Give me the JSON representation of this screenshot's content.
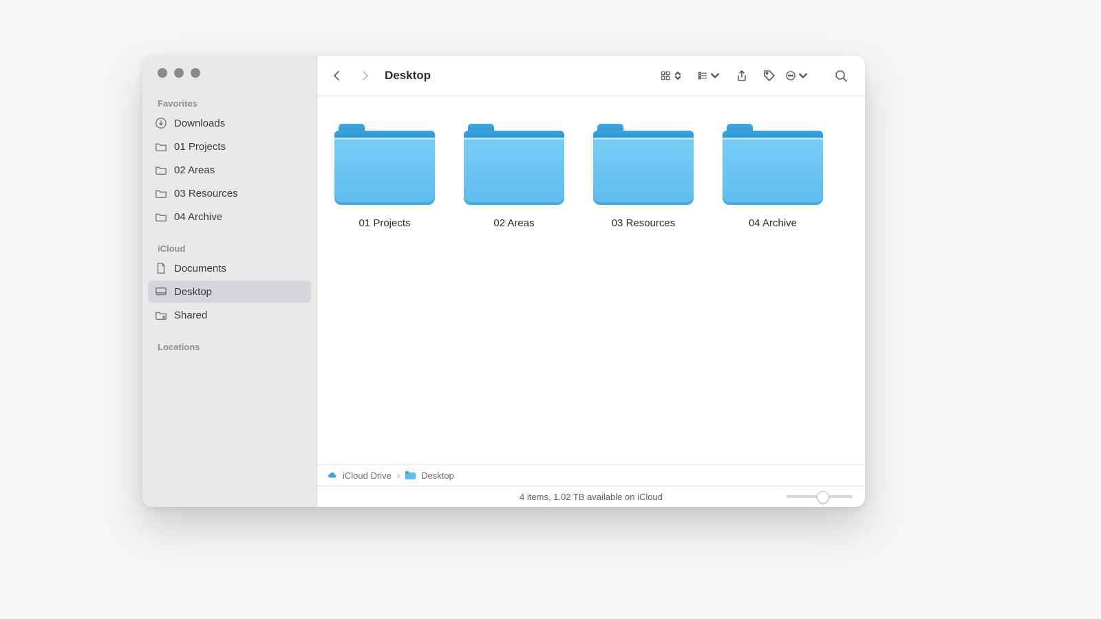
{
  "header": {
    "title": "Desktop"
  },
  "sidebar": {
    "favorites_header": "Favorites",
    "icloud_header": "iCloud",
    "locations_header": "Locations",
    "favorites": [
      {
        "label": "Downloads",
        "icon": "download"
      },
      {
        "label": "01 Projects",
        "icon": "folder"
      },
      {
        "label": "02 Areas",
        "icon": "folder"
      },
      {
        "label": "03 Resources",
        "icon": "folder"
      },
      {
        "label": "04 Archive",
        "icon": "folder"
      }
    ],
    "icloud": [
      {
        "label": "Documents",
        "icon": "document"
      },
      {
        "label": "Desktop",
        "icon": "desktop",
        "selected": true
      },
      {
        "label": "Shared",
        "icon": "shared"
      }
    ]
  },
  "items": [
    {
      "label": "01 Projects"
    },
    {
      "label": "02 Areas"
    },
    {
      "label": "03 Resources"
    },
    {
      "label": "04 Archive"
    }
  ],
  "pathbar": {
    "root": "iCloud Drive",
    "current": "Desktop"
  },
  "status": {
    "text": "4 items, 1.02 TB available on iCloud"
  }
}
